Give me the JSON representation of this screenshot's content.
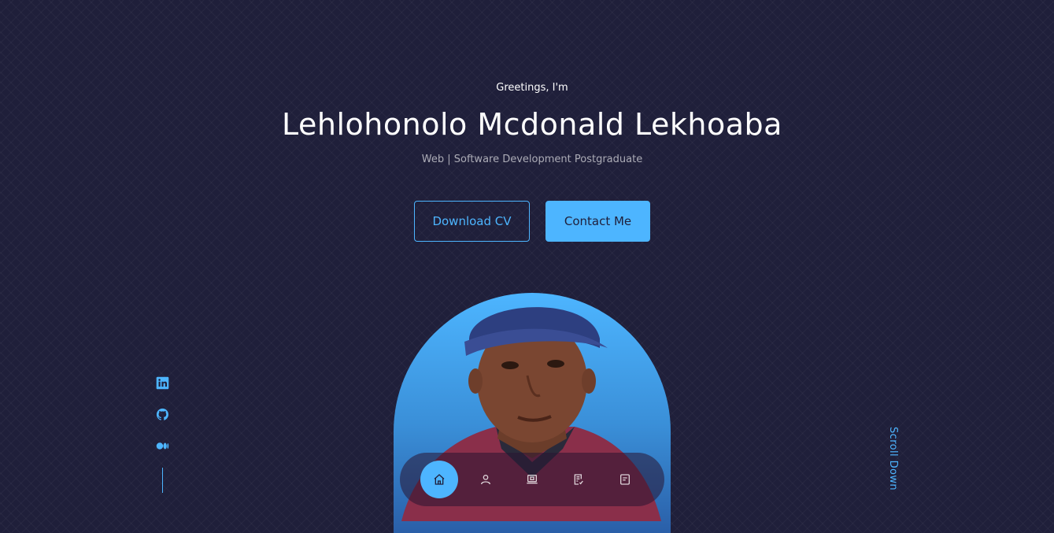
{
  "hero": {
    "greeting": "Greetings, I'm",
    "name": "Lehlohonolo Mcdonald Lekhoaba",
    "subtitle": "Web | Software Development Postgraduate"
  },
  "buttons": {
    "download_cv": "Download CV",
    "contact_me": "Contact Me"
  },
  "socials": [
    {
      "icon": "linkedin-icon"
    },
    {
      "icon": "github-icon"
    },
    {
      "icon": "medium-icon"
    }
  ],
  "scroll_down": "Scroll Down",
  "nav": {
    "items": [
      {
        "icon": "home-icon",
        "active": true
      },
      {
        "icon": "user-icon",
        "active": false
      },
      {
        "icon": "laptop-icon",
        "active": false
      },
      {
        "icon": "checklist-icon",
        "active": false
      },
      {
        "icon": "message-icon",
        "active": false
      }
    ]
  },
  "colors": {
    "background": "#1f1f3a",
    "accent": "#4db5ff",
    "text": "#ffffff"
  }
}
